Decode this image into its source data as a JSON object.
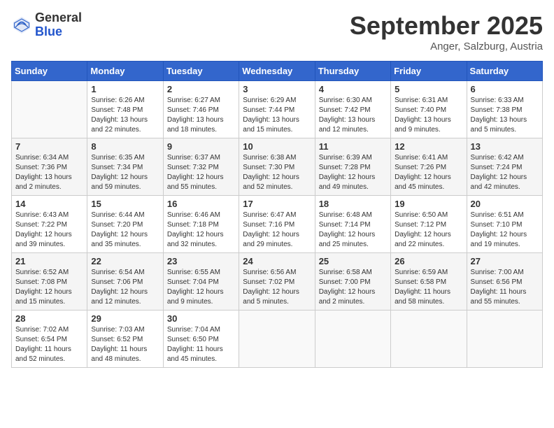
{
  "logo": {
    "general": "General",
    "blue": "Blue"
  },
  "header": {
    "month": "September 2025",
    "location": "Anger, Salzburg, Austria"
  },
  "weekdays": [
    "Sunday",
    "Monday",
    "Tuesday",
    "Wednesday",
    "Thursday",
    "Friday",
    "Saturday"
  ],
  "weeks": [
    [
      {
        "day": "",
        "sunrise": "",
        "sunset": "",
        "daylight": ""
      },
      {
        "day": "1",
        "sunrise": "Sunrise: 6:26 AM",
        "sunset": "Sunset: 7:48 PM",
        "daylight": "Daylight: 13 hours and 22 minutes."
      },
      {
        "day": "2",
        "sunrise": "Sunrise: 6:27 AM",
        "sunset": "Sunset: 7:46 PM",
        "daylight": "Daylight: 13 hours and 18 minutes."
      },
      {
        "day": "3",
        "sunrise": "Sunrise: 6:29 AM",
        "sunset": "Sunset: 7:44 PM",
        "daylight": "Daylight: 13 hours and 15 minutes."
      },
      {
        "day": "4",
        "sunrise": "Sunrise: 6:30 AM",
        "sunset": "Sunset: 7:42 PM",
        "daylight": "Daylight: 13 hours and 12 minutes."
      },
      {
        "day": "5",
        "sunrise": "Sunrise: 6:31 AM",
        "sunset": "Sunset: 7:40 PM",
        "daylight": "Daylight: 13 hours and 9 minutes."
      },
      {
        "day": "6",
        "sunrise": "Sunrise: 6:33 AM",
        "sunset": "Sunset: 7:38 PM",
        "daylight": "Daylight: 13 hours and 5 minutes."
      }
    ],
    [
      {
        "day": "7",
        "sunrise": "Sunrise: 6:34 AM",
        "sunset": "Sunset: 7:36 PM",
        "daylight": "Daylight: 13 hours and 2 minutes."
      },
      {
        "day": "8",
        "sunrise": "Sunrise: 6:35 AM",
        "sunset": "Sunset: 7:34 PM",
        "daylight": "Daylight: 12 hours and 59 minutes."
      },
      {
        "day": "9",
        "sunrise": "Sunrise: 6:37 AM",
        "sunset": "Sunset: 7:32 PM",
        "daylight": "Daylight: 12 hours and 55 minutes."
      },
      {
        "day": "10",
        "sunrise": "Sunrise: 6:38 AM",
        "sunset": "Sunset: 7:30 PM",
        "daylight": "Daylight: 12 hours and 52 minutes."
      },
      {
        "day": "11",
        "sunrise": "Sunrise: 6:39 AM",
        "sunset": "Sunset: 7:28 PM",
        "daylight": "Daylight: 12 hours and 49 minutes."
      },
      {
        "day": "12",
        "sunrise": "Sunrise: 6:41 AM",
        "sunset": "Sunset: 7:26 PM",
        "daylight": "Daylight: 12 hours and 45 minutes."
      },
      {
        "day": "13",
        "sunrise": "Sunrise: 6:42 AM",
        "sunset": "Sunset: 7:24 PM",
        "daylight": "Daylight: 12 hours and 42 minutes."
      }
    ],
    [
      {
        "day": "14",
        "sunrise": "Sunrise: 6:43 AM",
        "sunset": "Sunset: 7:22 PM",
        "daylight": "Daylight: 12 hours and 39 minutes."
      },
      {
        "day": "15",
        "sunrise": "Sunrise: 6:44 AM",
        "sunset": "Sunset: 7:20 PM",
        "daylight": "Daylight: 12 hours and 35 minutes."
      },
      {
        "day": "16",
        "sunrise": "Sunrise: 6:46 AM",
        "sunset": "Sunset: 7:18 PM",
        "daylight": "Daylight: 12 hours and 32 minutes."
      },
      {
        "day": "17",
        "sunrise": "Sunrise: 6:47 AM",
        "sunset": "Sunset: 7:16 PM",
        "daylight": "Daylight: 12 hours and 29 minutes."
      },
      {
        "day": "18",
        "sunrise": "Sunrise: 6:48 AM",
        "sunset": "Sunset: 7:14 PM",
        "daylight": "Daylight: 12 hours and 25 minutes."
      },
      {
        "day": "19",
        "sunrise": "Sunrise: 6:50 AM",
        "sunset": "Sunset: 7:12 PM",
        "daylight": "Daylight: 12 hours and 22 minutes."
      },
      {
        "day": "20",
        "sunrise": "Sunrise: 6:51 AM",
        "sunset": "Sunset: 7:10 PM",
        "daylight": "Daylight: 12 hours and 19 minutes."
      }
    ],
    [
      {
        "day": "21",
        "sunrise": "Sunrise: 6:52 AM",
        "sunset": "Sunset: 7:08 PM",
        "daylight": "Daylight: 12 hours and 15 minutes."
      },
      {
        "day": "22",
        "sunrise": "Sunrise: 6:54 AM",
        "sunset": "Sunset: 7:06 PM",
        "daylight": "Daylight: 12 hours and 12 minutes."
      },
      {
        "day": "23",
        "sunrise": "Sunrise: 6:55 AM",
        "sunset": "Sunset: 7:04 PM",
        "daylight": "Daylight: 12 hours and 9 minutes."
      },
      {
        "day": "24",
        "sunrise": "Sunrise: 6:56 AM",
        "sunset": "Sunset: 7:02 PM",
        "daylight": "Daylight: 12 hours and 5 minutes."
      },
      {
        "day": "25",
        "sunrise": "Sunrise: 6:58 AM",
        "sunset": "Sunset: 7:00 PM",
        "daylight": "Daylight: 12 hours and 2 minutes."
      },
      {
        "day": "26",
        "sunrise": "Sunrise: 6:59 AM",
        "sunset": "Sunset: 6:58 PM",
        "daylight": "Daylight: 11 hours and 58 minutes."
      },
      {
        "day": "27",
        "sunrise": "Sunrise: 7:00 AM",
        "sunset": "Sunset: 6:56 PM",
        "daylight": "Daylight: 11 hours and 55 minutes."
      }
    ],
    [
      {
        "day": "28",
        "sunrise": "Sunrise: 7:02 AM",
        "sunset": "Sunset: 6:54 PM",
        "daylight": "Daylight: 11 hours and 52 minutes."
      },
      {
        "day": "29",
        "sunrise": "Sunrise: 7:03 AM",
        "sunset": "Sunset: 6:52 PM",
        "daylight": "Daylight: 11 hours and 48 minutes."
      },
      {
        "day": "30",
        "sunrise": "Sunrise: 7:04 AM",
        "sunset": "Sunset: 6:50 PM",
        "daylight": "Daylight: 11 hours and 45 minutes."
      },
      {
        "day": "",
        "sunrise": "",
        "sunset": "",
        "daylight": ""
      },
      {
        "day": "",
        "sunrise": "",
        "sunset": "",
        "daylight": ""
      },
      {
        "day": "",
        "sunrise": "",
        "sunset": "",
        "daylight": ""
      },
      {
        "day": "",
        "sunrise": "",
        "sunset": "",
        "daylight": ""
      }
    ]
  ]
}
